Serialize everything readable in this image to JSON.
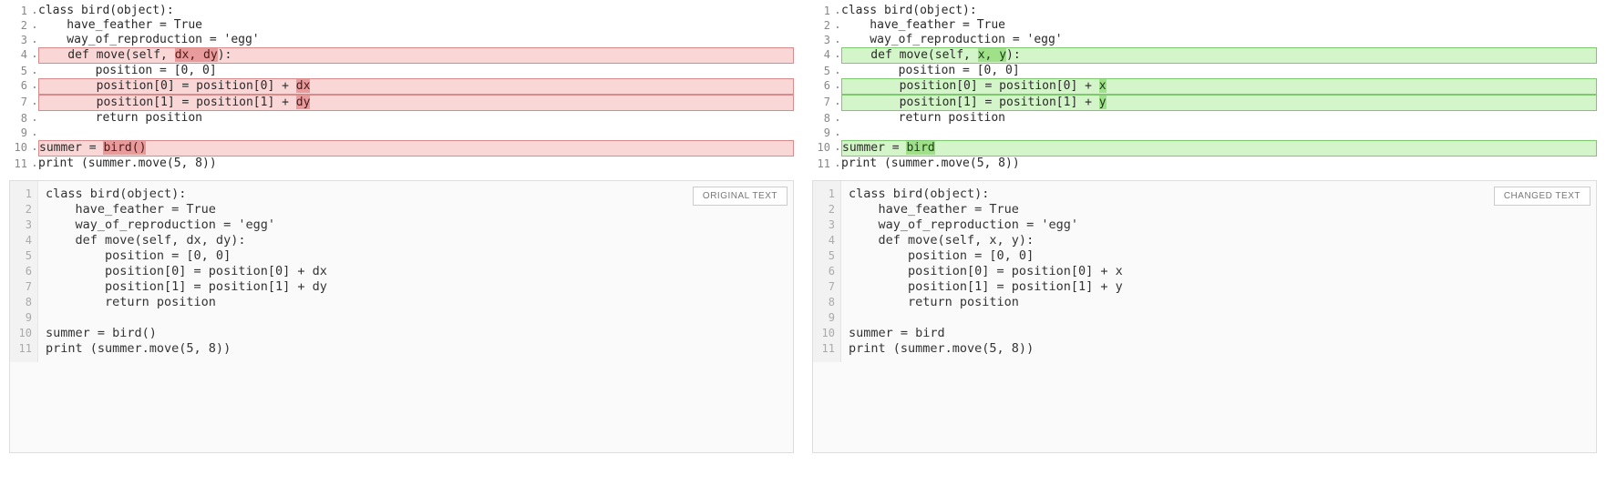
{
  "left": {
    "badge": "ORIGINAL TEXT",
    "lines": [
      {
        "n": 1,
        "cls": "",
        "parts": [
          {
            "t": "class bird(object):"
          }
        ]
      },
      {
        "n": 2,
        "cls": "",
        "parts": [
          {
            "t": "    have_feather = True"
          }
        ]
      },
      {
        "n": 3,
        "cls": "",
        "parts": [
          {
            "t": "    way_of_reproduction = 'egg'"
          }
        ]
      },
      {
        "n": 4,
        "cls": "hl-del",
        "parts": [
          {
            "t": "    def move(self, "
          },
          {
            "t": "dx, dy",
            "w": "word-del"
          },
          {
            "t": "):"
          }
        ]
      },
      {
        "n": 5,
        "cls": "",
        "parts": [
          {
            "t": "        position = [0, 0]"
          }
        ]
      },
      {
        "n": 6,
        "cls": "hl-del",
        "parts": [
          {
            "t": "        position[0] = position[0] + "
          },
          {
            "t": "dx",
            "w": "word-del"
          }
        ]
      },
      {
        "n": 7,
        "cls": "hl-del",
        "parts": [
          {
            "t": "        position[1] = position[1] + "
          },
          {
            "t": "dy",
            "w": "word-del"
          }
        ]
      },
      {
        "n": 8,
        "cls": "",
        "parts": [
          {
            "t": "        return position"
          }
        ]
      },
      {
        "n": 9,
        "cls": "",
        "parts": [
          {
            "t": ""
          }
        ]
      },
      {
        "n": 10,
        "cls": "hl-del",
        "parts": [
          {
            "t": "summer = "
          },
          {
            "t": "bird()",
            "w": "word-del"
          }
        ]
      },
      {
        "n": 11,
        "cls": "",
        "parts": [
          {
            "t": "print (summer.move(5, 8))"
          }
        ]
      }
    ],
    "plain": [
      "class bird(object):",
      "    have_feather = True",
      "    way_of_reproduction = 'egg'",
      "    def move(self, dx, dy):",
      "        position = [0, 0]",
      "        position[0] = position[0] + dx",
      "        position[1] = position[1] + dy",
      "        return position",
      "",
      "summer = bird()",
      "print (summer.move(5, 8))"
    ]
  },
  "right": {
    "badge": "CHANGED TEXT",
    "lines": [
      {
        "n": 1,
        "cls": "",
        "parts": [
          {
            "t": "class bird(object):"
          }
        ]
      },
      {
        "n": 2,
        "cls": "",
        "parts": [
          {
            "t": "    have_feather = True"
          }
        ]
      },
      {
        "n": 3,
        "cls": "",
        "parts": [
          {
            "t": "    way_of_reproduction = 'egg'"
          }
        ]
      },
      {
        "n": 4,
        "cls": "hl-add",
        "parts": [
          {
            "t": "    def move(self, "
          },
          {
            "t": "x, y",
            "w": "word-add"
          },
          {
            "t": "):"
          }
        ]
      },
      {
        "n": 5,
        "cls": "",
        "parts": [
          {
            "t": "        position = [0, 0]"
          }
        ]
      },
      {
        "n": 6,
        "cls": "hl-add",
        "parts": [
          {
            "t": "        position[0] = position[0] + "
          },
          {
            "t": "x",
            "w": "word-add"
          }
        ]
      },
      {
        "n": 7,
        "cls": "hl-add",
        "parts": [
          {
            "t": "        position[1] = position[1] + "
          },
          {
            "t": "y",
            "w": "word-add"
          }
        ]
      },
      {
        "n": 8,
        "cls": "",
        "parts": [
          {
            "t": "        return position"
          }
        ]
      },
      {
        "n": 9,
        "cls": "",
        "parts": [
          {
            "t": ""
          }
        ]
      },
      {
        "n": 10,
        "cls": "hl-add",
        "parts": [
          {
            "t": "summer = "
          },
          {
            "t": "bird",
            "w": "word-add"
          }
        ]
      },
      {
        "n": 11,
        "cls": "",
        "parts": [
          {
            "t": "print (summer.move(5, 8))"
          }
        ]
      }
    ],
    "plain": [
      "class bird(object):",
      "    have_feather = True",
      "    way_of_reproduction = 'egg'",
      "    def move(self, x, y):",
      "        position = [0, 0]",
      "        position[0] = position[0] + x",
      "        position[1] = position[1] + y",
      "        return position",
      "",
      "summer = bird",
      "print (summer.move(5, 8))"
    ]
  }
}
